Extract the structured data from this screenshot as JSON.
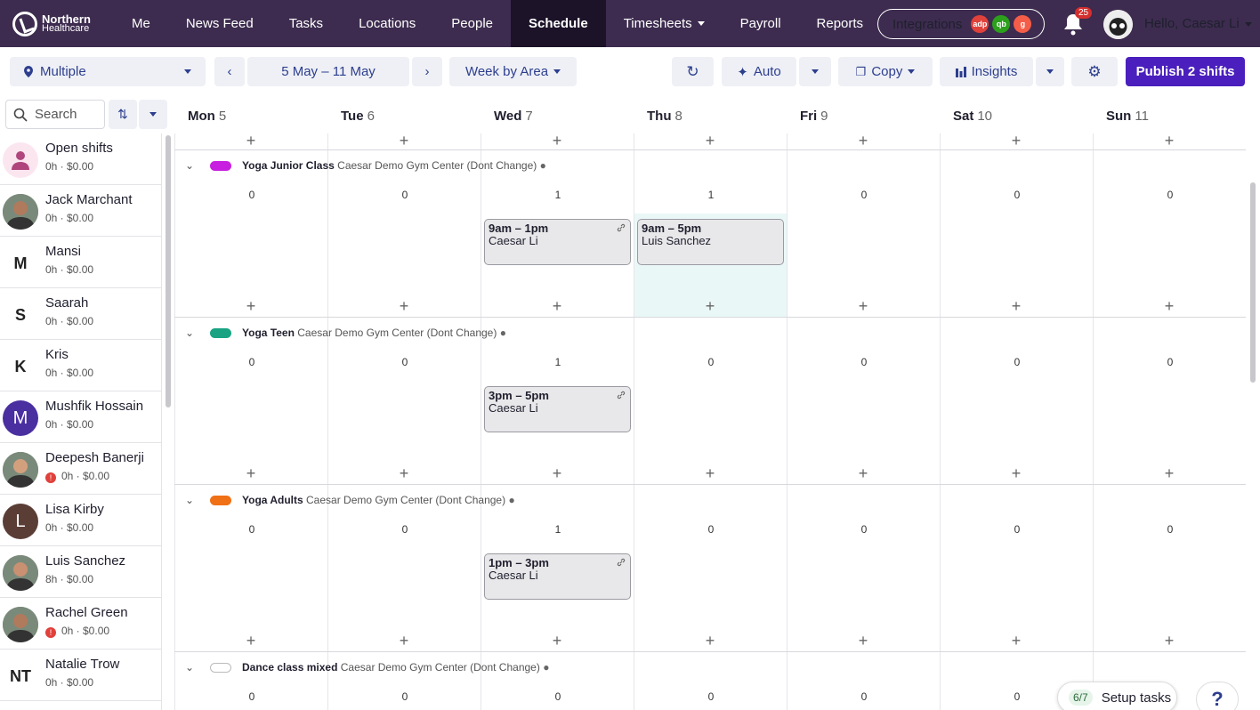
{
  "brand": {
    "line1": "Northern",
    "line2": "Healthcare"
  },
  "nav": {
    "items": [
      "Me",
      "News Feed",
      "Tasks",
      "Locations",
      "People",
      "Schedule",
      "Timesheets",
      "Payroll",
      "Reports"
    ],
    "active": "Schedule",
    "integrations_label": "Integrations",
    "integration_badges": [
      {
        "icon": "adp-icon",
        "color": "#e0413b"
      },
      {
        "icon": "quickbooks-icon",
        "color": "#2ca01c"
      },
      {
        "icon": "gusto-icon",
        "color": "#f45d48"
      }
    ],
    "notifications_count": "25",
    "greeting": "Hello, Caesar Li"
  },
  "toolbar": {
    "location": "Multiple",
    "date_range": "5 May – 11 May",
    "view": "Week by Area",
    "auto": "Auto",
    "copy": "Copy",
    "insights": "Insights",
    "publish": "Publish 2 shifts"
  },
  "search": {
    "placeholder": "Search"
  },
  "days": [
    {
      "name": "Mon",
      "num": "5"
    },
    {
      "name": "Tue",
      "num": "6"
    },
    {
      "name": "Wed",
      "num": "7"
    },
    {
      "name": "Thu",
      "num": "8"
    },
    {
      "name": "Fri",
      "num": "9"
    },
    {
      "name": "Sat",
      "num": "10"
    },
    {
      "name": "Sun",
      "num": "11"
    }
  ],
  "people": [
    {
      "name": "Open shifts",
      "meta": "0h · $0.00",
      "avatar": "open-shifts-icon",
      "initials": ""
    },
    {
      "name": "Jack Marchant",
      "meta": "0h · $0.00",
      "avatar": "photo",
      "initials": ""
    },
    {
      "name": "Mansi",
      "meta": "0h · $0.00",
      "avatar": "initials",
      "initials": "M"
    },
    {
      "name": "Saarah",
      "meta": "0h · $0.00",
      "avatar": "initials",
      "initials": "S"
    },
    {
      "name": "Kris",
      "meta": "0h · $0.00",
      "avatar": "initials",
      "initials": "K"
    },
    {
      "name": "Mushfik Hossain",
      "meta": "0h · $0.00",
      "avatar": "circle",
      "initials": "M",
      "color": "#4a2fa0"
    },
    {
      "name": "Deepesh Banerji",
      "meta": "0h · $0.00",
      "avatar": "photo",
      "initials": "",
      "warning": true
    },
    {
      "name": "Lisa Kirby",
      "meta": "0h · $0.00",
      "avatar": "circle",
      "initials": "L",
      "color": "#5a3e36"
    },
    {
      "name": "Luis Sanchez",
      "meta": "8h · $0.00",
      "avatar": "photo",
      "initials": ""
    },
    {
      "name": "Rachel Green",
      "meta": "0h · $0.00",
      "avatar": "photo",
      "initials": "",
      "warning": true
    },
    {
      "name": "Natalie Trow",
      "meta": "0h · $0.00",
      "avatar": "initials",
      "initials": "NT"
    }
  ],
  "areas": [
    {
      "name": "Yoga Junior Class",
      "location": "Caesar Demo Gym Center (Dont Change)",
      "color": "#c81ee0",
      "counts": [
        "0",
        "0",
        "1",
        "1",
        "0",
        "0",
        "0"
      ],
      "shifts": [
        {
          "day": 2,
          "time": "9am – 1pm",
          "person": "Caesar Li",
          "linked": true
        },
        {
          "day": 3,
          "time": "9am – 5pm",
          "person": "Luis Sanchez",
          "linked": false
        }
      ]
    },
    {
      "name": "Yoga Teen",
      "location": "Caesar Demo Gym Center (Dont Change)",
      "color": "#19a383",
      "counts": [
        "0",
        "0",
        "1",
        "0",
        "0",
        "0",
        "0"
      ],
      "shifts": [
        {
          "day": 2,
          "time": "3pm – 5pm",
          "person": "Caesar Li",
          "linked": true
        }
      ]
    },
    {
      "name": "Yoga Adults",
      "location": "Caesar Demo Gym Center (Dont Change)",
      "color": "#f07015",
      "counts": [
        "0",
        "0",
        "1",
        "0",
        "0",
        "0",
        "0"
      ],
      "shifts": [
        {
          "day": 2,
          "time": "1pm – 3pm",
          "person": "Caesar Li",
          "linked": true
        }
      ]
    },
    {
      "name": "Dance class mixed",
      "location": "Caesar Demo Gym Center (Dont Change)",
      "color": "#ffffff",
      "counts": [
        "0",
        "0",
        "0",
        "0",
        "0",
        "0",
        ""
      ],
      "shifts": []
    }
  ],
  "setup": {
    "progress": "6/7",
    "label": "Setup tasks"
  },
  "help": {
    "label": "?"
  }
}
